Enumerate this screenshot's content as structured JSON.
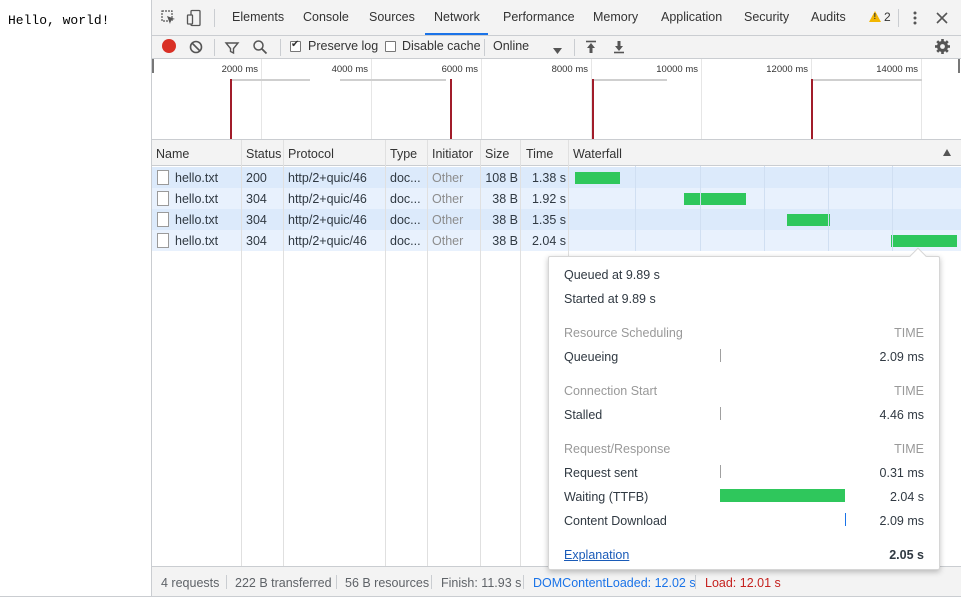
{
  "page": {
    "text": "Hello, world!"
  },
  "tabs": [
    "Elements",
    "Console",
    "Sources",
    "Network",
    "Performance",
    "Memory",
    "Application",
    "Security",
    "Audits"
  ],
  "active_tab": "Network",
  "warnings_count": "2",
  "toolbar": {
    "preserve_log": "Preserve log",
    "disable_cache": "Disable cache",
    "throttle": "Online"
  },
  "overview": {
    "ticks": [
      "2000 ms",
      "4000 ms",
      "6000 ms",
      "8000 ms",
      "10000 ms",
      "12000 ms",
      "14000 ms"
    ]
  },
  "table": {
    "headers": [
      "Name",
      "Status",
      "Protocol",
      "Type",
      "Initiator",
      "Size",
      "Time",
      "Waterfall"
    ],
    "rows": [
      {
        "name": "hello.txt",
        "status": "200",
        "protocol": "http/2+quic/46",
        "type": "doc...",
        "initiator": "Other",
        "size": "108 B",
        "time": "1.38 s"
      },
      {
        "name": "hello.txt",
        "status": "304",
        "protocol": "http/2+quic/46",
        "type": "doc...",
        "initiator": "Other",
        "size": "38 B",
        "time": "1.92 s"
      },
      {
        "name": "hello.txt",
        "status": "304",
        "protocol": "http/2+quic/46",
        "type": "doc...",
        "initiator": "Other",
        "size": "38 B",
        "time": "1.35 s"
      },
      {
        "name": "hello.txt",
        "status": "304",
        "protocol": "http/2+quic/46",
        "type": "doc...",
        "initiator": "Other",
        "size": "38 B",
        "time": "2.04 s"
      }
    ]
  },
  "status_bar": {
    "requests": "4 requests",
    "transferred": "222 B transferred",
    "resources": "56 B resources",
    "finish": "Finish: 11.93 s",
    "dom_content_loaded": "DOMContentLoaded: 12.02 s",
    "load": "Load: 12.01 s"
  },
  "timing_popover": {
    "queued_at": "Queued at 9.89 s",
    "started_at": "Started at 9.89 s",
    "time_label": "TIME",
    "resource_scheduling": "Resource Scheduling",
    "queueing": "Queueing",
    "queueing_time": "2.09 ms",
    "connection_start": "Connection Start",
    "stalled": "Stalled",
    "stalled_time": "4.46 ms",
    "request_response": "Request/Response",
    "request_sent": "Request sent",
    "request_sent_time": "0.31 ms",
    "waiting": "Waiting (TTFB)",
    "waiting_time": "2.04 s",
    "content_download": "Content Download",
    "content_download_time": "2.09 ms",
    "explanation": "Explanation",
    "total": "2.05 s"
  },
  "colors": {
    "waterfall_bar": "#2fc75c",
    "load_line": "#a11c2a",
    "dom_line": "#1a73e8",
    "active_tab_underline": "#1a73e8",
    "record": "#d93025"
  }
}
